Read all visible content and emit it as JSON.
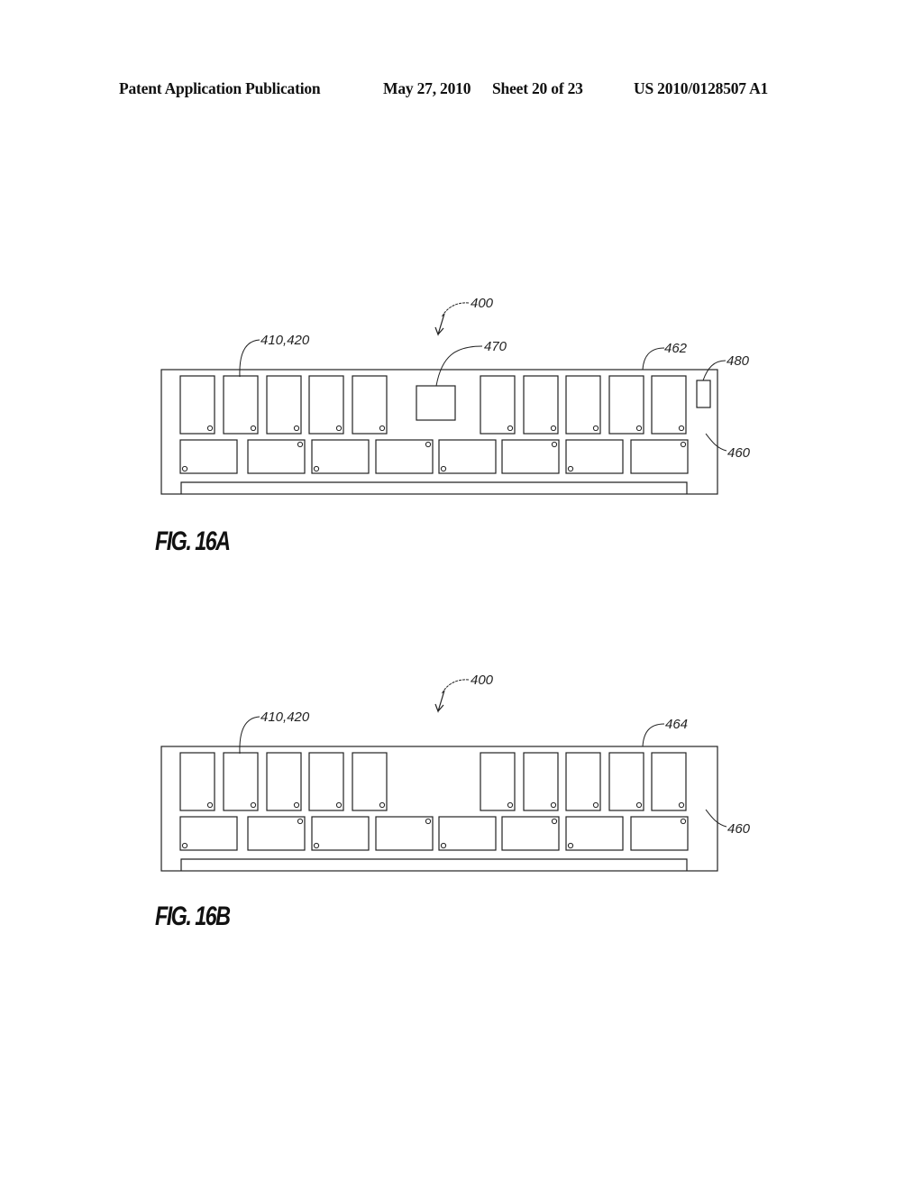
{
  "header": {
    "publication": "Patent Application Publication",
    "date": "May 27, 2010",
    "sheet": "Sheet 20 of 23",
    "number": "US 2010/0128507 A1"
  },
  "figures": [
    {
      "id": "16A",
      "label": "FIG. 16A",
      "refs": {
        "assembly": "400",
        "chips": "410,420",
        "center_chip": "470",
        "board_edge": "462",
        "side_component": "480",
        "board": "460"
      },
      "has_center_chip": true,
      "has_side_component": true
    },
    {
      "id": "16B",
      "label": "FIG. 16B",
      "refs": {
        "assembly": "400",
        "chips": "410,420",
        "board_edge": "464",
        "board": "460"
      },
      "has_center_chip": false,
      "has_side_component": false
    }
  ]
}
